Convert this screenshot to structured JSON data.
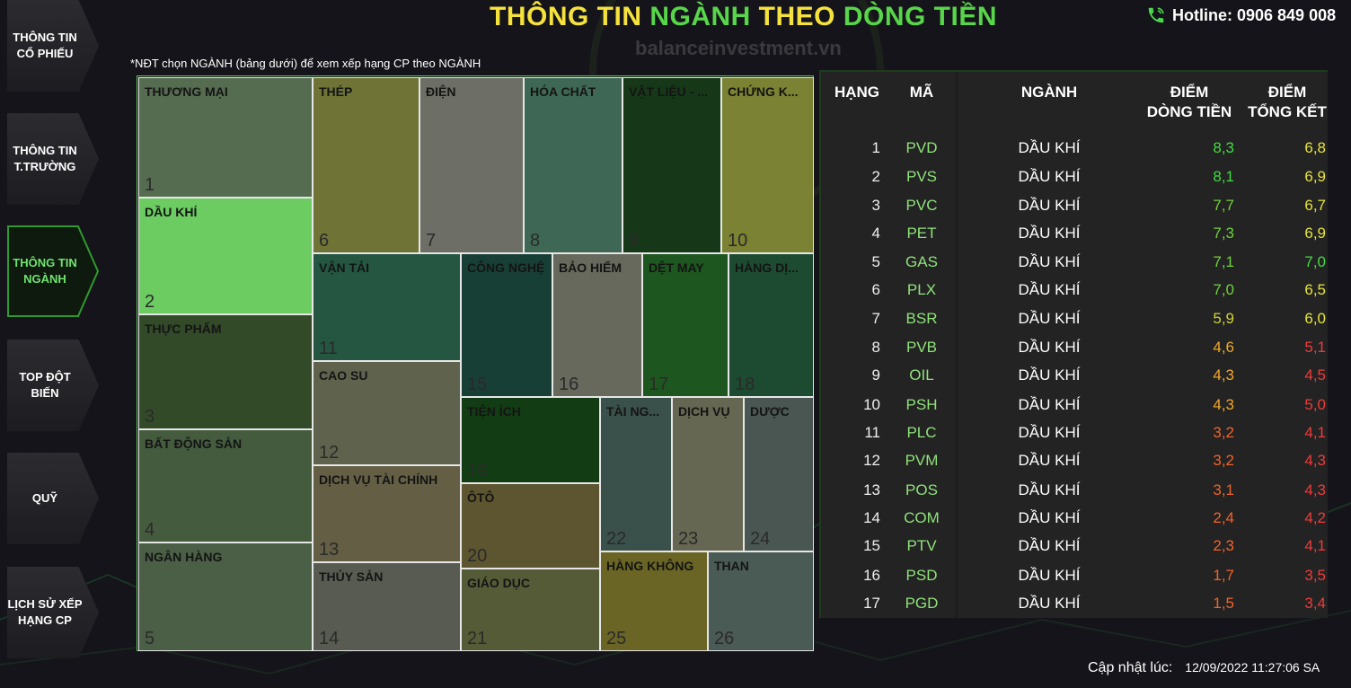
{
  "header": {
    "title_part1": "THÔNG TIN ",
    "title_part2": "NGÀNH",
    "title_part3": " THEO ",
    "title_part4": "DÒNG TIỀN",
    "watermark": "balanceinvestment.vn",
    "hotline": "Hotline: 0906 849 008",
    "hint": "*NĐT chọn NGÀNH (bảng dưới) để xem xếp hạng CP theo NGÀNH"
  },
  "sidebar": {
    "items": [
      {
        "label": "THÔNG TIN\nCỔ PHIẾU",
        "active": false
      },
      {
        "label": "THÔNG TIN\nT.TRƯỜNG",
        "active": false
      },
      {
        "label": "THÔNG TIN\nNGÀNH",
        "active": true
      },
      {
        "label": "TOP ĐỘT\nBIẾN",
        "active": false
      },
      {
        "label": "QUỸ",
        "active": false
      },
      {
        "label": "LỊCH SỬ XẾP\nHẠNG CP",
        "active": false
      }
    ]
  },
  "treemap": {
    "tiles": [
      {
        "name": "THƯƠNG MẠI",
        "num": "1",
        "color": "#566c50"
      },
      {
        "name": "DẦU KHÍ",
        "num": "2",
        "color": "#6ccc62"
      },
      {
        "name": "THỰC PHẨM",
        "num": "3",
        "color": "#334a29"
      },
      {
        "name": "BẤT ĐỘNG SẢN",
        "num": "4",
        "color": "#445b3e"
      },
      {
        "name": "NGÂN HÀNG",
        "num": "5",
        "color": "#4b5e46"
      },
      {
        "name": "THÉP",
        "num": "6",
        "color": "#6f7436"
      },
      {
        "name": "ĐIỆN",
        "num": "7",
        "color": "#6d6e65"
      },
      {
        "name": "HÓA CHẤT",
        "num": "8",
        "color": "#3e6855"
      },
      {
        "name": "VẬT LIỆU - ...",
        "num": "9",
        "color": "#163818"
      },
      {
        "name": "CHỨNG K...",
        "num": "10",
        "color": "#7b8233"
      },
      {
        "name": "VẬN TẢI",
        "num": "11",
        "color": "#245642"
      },
      {
        "name": "CÔNG NGHỆ",
        "num": "15",
        "color": "#183f36"
      },
      {
        "name": "BẢO HIỂM",
        "num": "16",
        "color": "#66695c"
      },
      {
        "name": "DỆT MAY",
        "num": "17",
        "color": "#1e561f"
      },
      {
        "name": "HÀNG DỊ...",
        "num": "18",
        "color": "#1d4b31"
      },
      {
        "name": "CAO SU",
        "num": "12",
        "color": "#5f634d"
      },
      {
        "name": "DỊCH VỤ TÀI CHÍNH",
        "num": "13",
        "color": "#635e44"
      },
      {
        "name": "THỦY SẢN",
        "num": "14",
        "color": "#575b51"
      },
      {
        "name": "TIỆN ÍCH",
        "num": "19",
        "color": "#123d14"
      },
      {
        "name": "ÔTÔ",
        "num": "20",
        "color": "#5c552f"
      },
      {
        "name": "GIÁO DỤC",
        "num": "21",
        "color": "#555b36"
      },
      {
        "name": "TÀI NG...",
        "num": "22",
        "color": "#3a504a"
      },
      {
        "name": "DỊCH VỤ",
        "num": "23",
        "color": "#666752"
      },
      {
        "name": "DƯỢC",
        "num": "24",
        "color": "#4a5652"
      },
      {
        "name": "HÀNG KHÔNG",
        "num": "25",
        "color": "#6a6524"
      },
      {
        "name": "THAN",
        "num": "26",
        "color": "#4a5a55"
      }
    ]
  },
  "ranking": {
    "headers": {
      "rank": "HẠNG",
      "code": "MÃ",
      "industry": "NGÀNH",
      "flow": "ĐIỂM\nDÒNG TIỀN",
      "total": "ĐIỂM\nTỔNG KẾT"
    },
    "rows": [
      {
        "rank": "1",
        "code": "PVD",
        "industry": "DẦU KHÍ",
        "flow": "8,3",
        "total": "6,8",
        "flow_color": "#3fdc3f",
        "total_color": "#e6e33a"
      },
      {
        "rank": "2",
        "code": "PVS",
        "industry": "DẦU KHÍ",
        "flow": "8,1",
        "total": "6,9",
        "flow_color": "#3fdc3f",
        "total_color": "#e6e33a"
      },
      {
        "rank": "3",
        "code": "PVC",
        "industry": "DẦU KHÍ",
        "flow": "7,7",
        "total": "6,7",
        "flow_color": "#6fd23a",
        "total_color": "#e6e33a"
      },
      {
        "rank": "4",
        "code": "PET",
        "industry": "DẦU KHÍ",
        "flow": "7,3",
        "total": "6,9",
        "flow_color": "#6fd23a",
        "total_color": "#e6e33a"
      },
      {
        "rank": "5",
        "code": "GAS",
        "industry": "DẦU KHÍ",
        "flow": "7,1",
        "total": "7,0",
        "flow_color": "#6fd23a",
        "total_color": "#3fdc3f"
      },
      {
        "rank": "6",
        "code": "PLX",
        "industry": "DẦU KHÍ",
        "flow": "7,0",
        "total": "6,5",
        "flow_color": "#6fd23a",
        "total_color": "#e6e33a"
      },
      {
        "rank": "7",
        "code": "BSR",
        "industry": "DẦU KHÍ",
        "flow": "5,9",
        "total": "6,0",
        "flow_color": "#cfd23a",
        "total_color": "#e6e33a"
      },
      {
        "rank": "8",
        "code": "PVB",
        "industry": "DẦU KHÍ",
        "flow": "4,6",
        "total": "5,1",
        "flow_color": "#f0a82a",
        "total_color": "#ee3b3b"
      },
      {
        "rank": "9",
        "code": "OIL",
        "industry": "DẦU KHÍ",
        "flow": "4,3",
        "total": "4,5",
        "flow_color": "#f0a82a",
        "total_color": "#ee3b3b"
      },
      {
        "rank": "10",
        "code": "PSH",
        "industry": "DẦU KHÍ",
        "flow": "4,3",
        "total": "5,0",
        "flow_color": "#f0a82a",
        "total_color": "#ee3b3b"
      },
      {
        "rank": "11",
        "code": "PLC",
        "industry": "DẦU KHÍ",
        "flow": "3,2",
        "total": "4,1",
        "flow_color": "#f2632a",
        "total_color": "#ee3b3b"
      },
      {
        "rank": "12",
        "code": "PVM",
        "industry": "DẦU KHÍ",
        "flow": "3,2",
        "total": "4,3",
        "flow_color": "#f2632a",
        "total_color": "#ee3b3b"
      },
      {
        "rank": "13",
        "code": "POS",
        "industry": "DẦU KHÍ",
        "flow": "3,1",
        "total": "4,3",
        "flow_color": "#f2632a",
        "total_color": "#ee3b3b"
      },
      {
        "rank": "14",
        "code": "COM",
        "industry": "DẦU KHÍ",
        "flow": "2,4",
        "total": "4,2",
        "flow_color": "#f2632a",
        "total_color": "#ee3b3b"
      },
      {
        "rank": "15",
        "code": "PTV",
        "industry": "DẦU KHÍ",
        "flow": "2,3",
        "total": "4,1",
        "flow_color": "#f2632a",
        "total_color": "#ee3b3b"
      },
      {
        "rank": "16",
        "code": "PSD",
        "industry": "DẦU KHÍ",
        "flow": "1,7",
        "total": "3,5",
        "flow_color": "#f2632a",
        "total_color": "#ee3b3b"
      },
      {
        "rank": "17",
        "code": "PGD",
        "industry": "DẦU KHÍ",
        "flow": "1,5",
        "total": "3,4",
        "flow_color": "#f2632a",
        "total_color": "#ee3b3b"
      }
    ]
  },
  "footer": {
    "update_label": "Cập nhật lúc:",
    "update_time": "12/09/2022 11:27:06 SA"
  }
}
